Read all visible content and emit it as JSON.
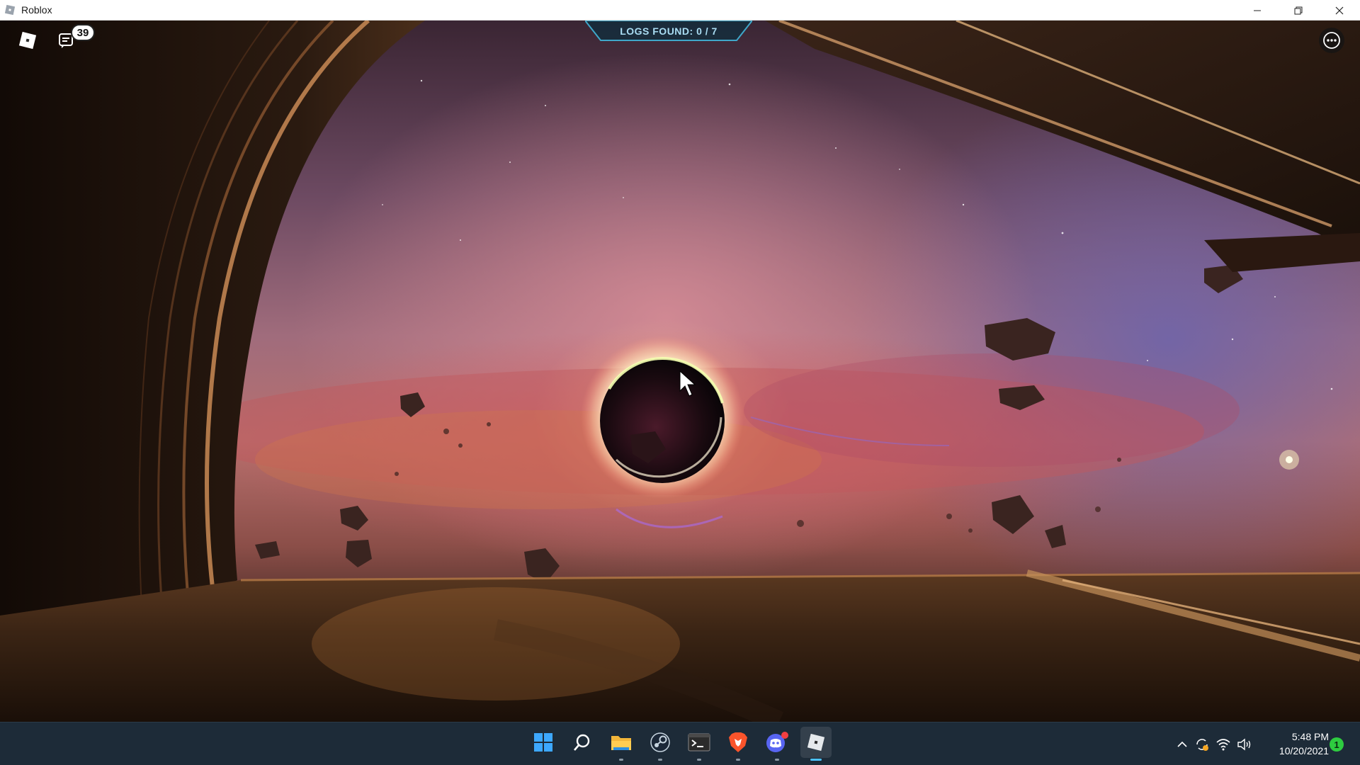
{
  "window": {
    "title": "Roblox"
  },
  "hud": {
    "logs_found": "LOGS FOUND: 0 / 7",
    "chat_badge_count": "39"
  },
  "taskbar": {
    "apps": [
      {
        "name": "start",
        "icon": "windows-logo-icon"
      },
      {
        "name": "search",
        "icon": "search-icon"
      },
      {
        "name": "file-explorer",
        "icon": "folder-icon"
      },
      {
        "name": "steam",
        "icon": "steam-icon"
      },
      {
        "name": "terminal",
        "icon": "terminal-icon"
      },
      {
        "name": "brave",
        "icon": "brave-lion-icon"
      },
      {
        "name": "discord",
        "icon": "discord-icon"
      },
      {
        "name": "roblox",
        "icon": "roblox-icon"
      }
    ],
    "time": "5:48 PM",
    "date": "10/20/2021",
    "notification_count": "1"
  },
  "colors": {
    "taskbar_bg": "#1d2b38",
    "hud_text": "#a9dcf2",
    "accent_blue": "#4cc2ff",
    "notification_green": "#2ecc40"
  }
}
